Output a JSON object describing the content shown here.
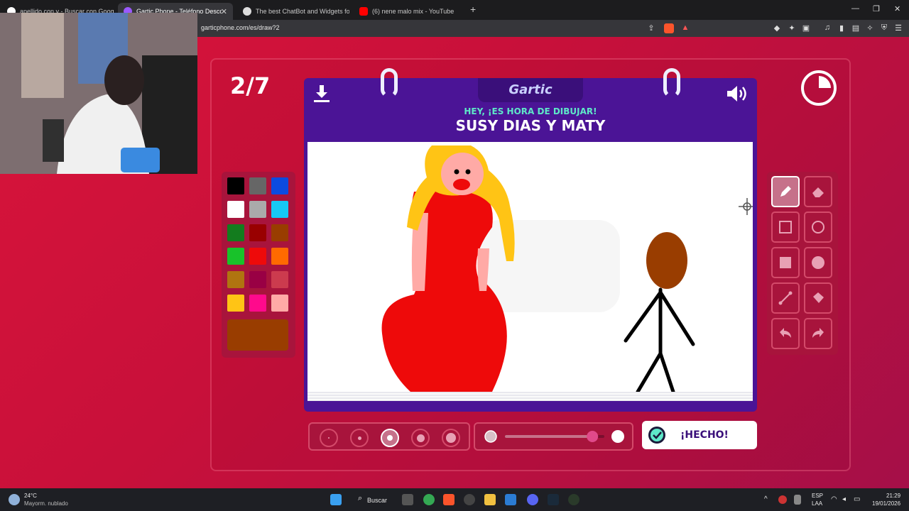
{
  "browser": {
    "tabs": [
      {
        "title": "apellido con y - Buscar con Google",
        "icon": "google-icon",
        "color": "#4285f4"
      },
      {
        "title": "Gartic Phone - Teléfono Descom",
        "icon": "gartic-icon",
        "color": "#9b59ff"
      },
      {
        "title": "The best ChatBot and Widgets fo",
        "icon": "chatbot-icon",
        "color": "#dddddd"
      },
      {
        "title": "(6) nene malo mix - YouTube",
        "icon": "youtube-icon",
        "color": "#ff0000"
      }
    ],
    "new_tab": "+",
    "url": "garticphone.com/es/draw?2",
    "window_controls": [
      "—",
      "❐",
      "✕"
    ]
  },
  "game": {
    "round": "2/7",
    "logo": "Gartic",
    "prompt_subtitle": "HEY, ¡ES HORA DE DIBUJAR!",
    "prompt_title": "SUSY DIAS Y MATY",
    "done_label": "¡HECHO!",
    "timer_fraction_elapsed": 0.25,
    "colors": [
      "#000000",
      "#666666",
      "#0b4be0",
      "#ffffff",
      "#aaaaaa",
      "#16c8f5",
      "#137c1e",
      "#990000",
      "#993d00",
      "#18c22a",
      "#ee0a0a",
      "#ff6a00",
      "#b07410",
      "#990044",
      "#cc3b4e",
      "#ffc415",
      "#ff0a8c",
      "#ffaaa6"
    ],
    "current_color": "#993d00",
    "tools": [
      {
        "name": "pencil",
        "selected": true
      },
      {
        "name": "eraser",
        "selected": false
      },
      {
        "name": "rectangle-outline",
        "selected": false
      },
      {
        "name": "circle-outline",
        "selected": false
      },
      {
        "name": "rectangle-filled",
        "selected": false
      },
      {
        "name": "circle-filled",
        "selected": false
      },
      {
        "name": "line",
        "selected": false
      },
      {
        "name": "fill-bucket",
        "selected": false
      },
      {
        "name": "undo",
        "selected": false
      },
      {
        "name": "redo",
        "selected": false
      }
    ],
    "brush_sizes": 5,
    "selected_brush_size": 3,
    "opacity_fraction": 0.88
  },
  "taskbar": {
    "weather_temp": "24°C",
    "weather_desc": "Mayorm. nublado",
    "search_label": "Buscar",
    "lang_top": "ESP",
    "lang_bottom": "LAA",
    "time": "21:29",
    "date": "19/01/2026"
  }
}
